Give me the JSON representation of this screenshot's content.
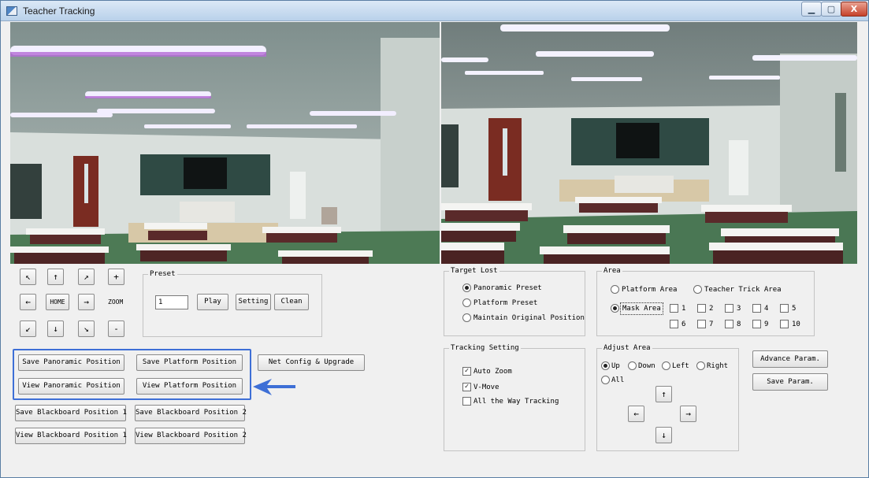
{
  "window": {
    "title": "Teacher Tracking",
    "buttons": {
      "minimize": "▁",
      "maximize": "▢",
      "close": "X"
    }
  },
  "ptz": {
    "up_left": "↖",
    "up": "↑",
    "up_right": "↗",
    "zoom_in": "+",
    "left": "←",
    "home": "HOME",
    "right": "→",
    "zoom_label": "ZOOM",
    "down_left": "↙",
    "down": "↓",
    "down_right": "↘",
    "zoom_out": "-"
  },
  "preset": {
    "title": "Preset",
    "value": "1",
    "play": "Play",
    "setting": "Setting",
    "clean": "Clean"
  },
  "positions": {
    "save_panoramic": "Save Panoramic Position",
    "save_platform": "Save Platform Position",
    "view_panoramic": "View Panoramic Position",
    "view_platform": "View Platform Position",
    "save_blackboard_1": "Save Blackboard Position 1",
    "save_blackboard_2": "Save Blackboard Position 2",
    "view_blackboard_1": "View Blackboard Position 1",
    "view_blackboard_2": "View Blackboard Position 2",
    "net_config": "Net Config & Upgrade"
  },
  "target_lost": {
    "title": "Target Lost",
    "options": [
      "Panoramic Preset",
      "Platform Preset",
      "Maintain Original Position"
    ],
    "selected": 0
  },
  "area": {
    "title": "Area",
    "platform_area": "Platform Area",
    "teacher_trick_area": "Teacher Trick Area",
    "mask_area": "Mask Area",
    "mask_numbers": [
      "1",
      "2",
      "3",
      "4",
      "5",
      "6",
      "7",
      "8",
      "9",
      "10"
    ]
  },
  "tracking": {
    "title": "Tracking Setting",
    "auto_zoom": "Auto Zoom",
    "v_move": "V-Move",
    "all_the_way": "All the Way Tracking"
  },
  "adjust": {
    "title": "Adjust Area",
    "up": "Up",
    "down": "Down",
    "left": "Left",
    "right": "Right",
    "all": "All",
    "arrow_up": "↑",
    "arrow_left": "←",
    "arrow_right": "→",
    "arrow_down": "↓"
  },
  "params": {
    "advance": "Advance Param.",
    "save": "Save Param."
  },
  "colors": {
    "highlight": "#3e6fd6",
    "titlebar": "#c9dcf0"
  }
}
